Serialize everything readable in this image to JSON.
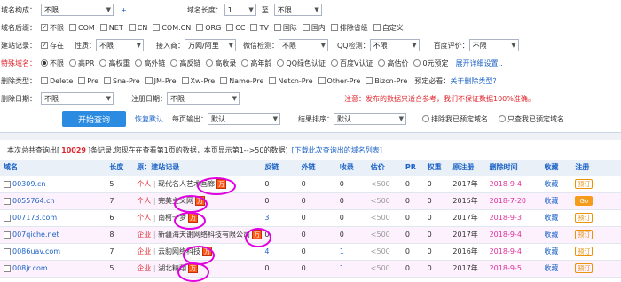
{
  "filters": {
    "row1": {
      "label": "域名构成：",
      "compose": "不限",
      "plus": "+",
      "len_label": "域名长度：",
      "len_from": "1",
      "to": "至",
      "len_to": "不限"
    },
    "row2": {
      "label": "域名后缀：",
      "options": [
        "不限",
        "COM",
        "NET",
        "CN",
        "COM.CN",
        "ORG",
        "CC",
        "TV",
        "国际",
        "国内",
        "排除省级",
        "自定义"
      ],
      "checked": "不限"
    },
    "row3": {
      "label": "建站记录：",
      "exist": "存在",
      "nature_label": "性质：",
      "nature": "不限",
      "access_label": "接入商：",
      "access": "万网/阿里",
      "wechat_label": "微信检测：",
      "wechat": "不限",
      "qq_label": "QQ检测：",
      "qq": "不限",
      "baidu_label": "百度评价：",
      "baidu": "不限"
    },
    "row4": {
      "label": "特殊域名：",
      "options": [
        "不限",
        "高PR",
        "高权重",
        "高外链",
        "高反链",
        "高收录",
        "高年龄",
        "QQ绿色认证",
        "百度V认证",
        "高估价",
        "0元预定"
      ],
      "checked": "不限",
      "expand": "展开详细设置.."
    },
    "row5": {
      "label": "删除类型：",
      "options": [
        "Delete",
        "Pre",
        "Sna-Pre",
        "JM-Pre",
        "Xw-Pre",
        "Name-Pre",
        "Netcn-Pre",
        "Other-Pre",
        "Bizcn-Pre"
      ],
      "hint": "预定必看：",
      "link": "关于删除类型？"
    },
    "row6": {
      "label": "删除日期：",
      "del_date": "不限",
      "reg_label": "注册日期：",
      "reg_date": "不限",
      "note": "注意：发布的数据只适合参考，我们不保证数据100%准确。"
    },
    "row7": {
      "search": "开始查询",
      "reset": "恢复默认",
      "perpage_label": "每页输出：",
      "perpage": "默认",
      "sort_label": "结果排序：",
      "sort": "默认",
      "opt1": "排除我已预定域名",
      "opt2": "只查我已预定域名"
    }
  },
  "info": {
    "pre": "本次总共查询出[",
    "count": "10029",
    "post": "]条记录,您现在在查看第1页的数据，本页显示第1-->50的数据)",
    "link": "[下载此次查询出的域名列表]"
  },
  "headers": [
    "域名",
    "长度",
    "原：建站记录",
    "反链",
    "外链",
    "收录",
    "估价",
    "PR",
    "权重",
    "原注册",
    "删除时间",
    "收藏",
    "注册"
  ],
  "rows": [
    {
      "domain": "00309.cn",
      "len": "5",
      "type": "个人",
      "record": "现代名人艺术画廊",
      "backlinks": "0",
      "outlinks": "0",
      "index": "0",
      "price": "<500",
      "pr": "0",
      "weight": "0",
      "year": "2017年",
      "del": "2018-9-4",
      "fav": "收藏",
      "reg": "预订"
    },
    {
      "domain": "0055764.cn",
      "len": "7",
      "type": "个人",
      "record": "完美主义网",
      "backlinks": "0",
      "outlinks": "0",
      "index": "0",
      "price": "<500",
      "pr": "0",
      "weight": "0",
      "year": "2015年",
      "del": "2018-7-20",
      "fav": "收藏",
      "reg": "Go"
    },
    {
      "domain": "007173.com",
      "len": "6",
      "type": "个人",
      "record": "南柯一梦",
      "backlinks": "3",
      "outlinks": "0",
      "index": "0",
      "price": "<500",
      "pr": "0",
      "weight": "0",
      "year": "2017年",
      "del": "2018-9-3",
      "fav": "收藏",
      "reg": "预订"
    },
    {
      "domain": "007qiche.net",
      "len": "8",
      "type": "企业",
      "record": "新疆海天谢网络科技有限公司",
      "backlinks": "0",
      "outlinks": "0",
      "index": "0",
      "price": "<500",
      "pr": "0",
      "weight": "0",
      "year": "2017年",
      "del": "2018-9-4",
      "fav": "收藏",
      "reg": "预订"
    },
    {
      "domain": "0086uav.com",
      "len": "7",
      "type": "企业",
      "record": "云豹网络科技",
      "backlinks": "4",
      "outlinks": "0",
      "index": "1",
      "price": "<500",
      "pr": "0",
      "weight": "0",
      "year": "2016年",
      "del": "2018-9-4",
      "fav": "收藏",
      "reg": "预订"
    },
    {
      "domain": "008jr.com",
      "len": "5",
      "type": "企业",
      "record": "湖北精翔",
      "backlinks": "0",
      "outlinks": "0",
      "index": "1",
      "price": "<500",
      "pr": "0",
      "weight": "0",
      "year": "2017年",
      "del": "2018-9-5",
      "fav": "收藏",
      "reg": "预订"
    }
  ],
  "colors": {
    "accent": "#1d63c7",
    "danger": "#e0282f",
    "pink_date": "#e0309a",
    "highlight": "#e000e0"
  }
}
